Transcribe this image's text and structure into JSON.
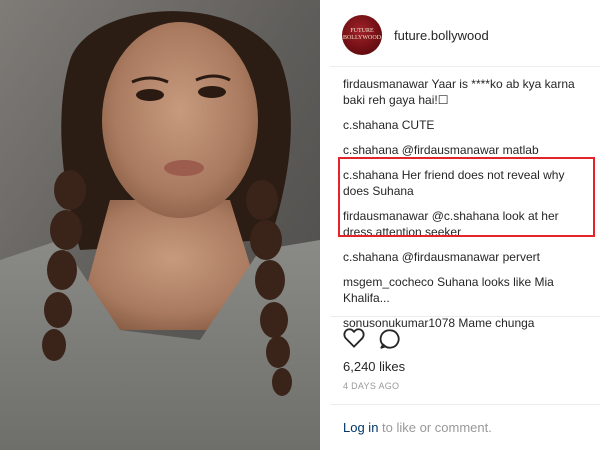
{
  "post": {
    "username": "future.bollywood",
    "avatar_text": [
      "FUTURE",
      "BOLLYWOOD"
    ],
    "comments": [
      {
        "user": "firdausmanawar",
        "text": "Yaar is ****ko ab kya karna baki reh gaya hai!☐"
      },
      {
        "user": "c.shahana",
        "text": "CUTE"
      },
      {
        "user": "c.shahana",
        "text": "@firdausmanawar matlab"
      },
      {
        "user": "c.shahana",
        "text": "Her friend does not reveal why does Suhana"
      },
      {
        "user": "firdausmanawar",
        "text": "@c.shahana look at her dress.attention seeker"
      },
      {
        "user": "c.shahana",
        "text": "@firdausmanawar pervert"
      },
      {
        "user": "msgem_cocheco",
        "text": "Suhana looks like Mia Khalifa..."
      },
      {
        "user": "sonusonukumar1078",
        "text": "Mame chunga"
      }
    ],
    "likes": "6,240 likes",
    "time": "4 DAYS AGO",
    "login_link": "Log in",
    "login_suffix": " to like or comment."
  },
  "icons": {
    "like": "heart-icon",
    "comment": "comment-bubble-icon"
  },
  "colors": {
    "highlight_border": "#e3242b",
    "link": "#003569",
    "muted": "#999999",
    "text": "#262626"
  }
}
